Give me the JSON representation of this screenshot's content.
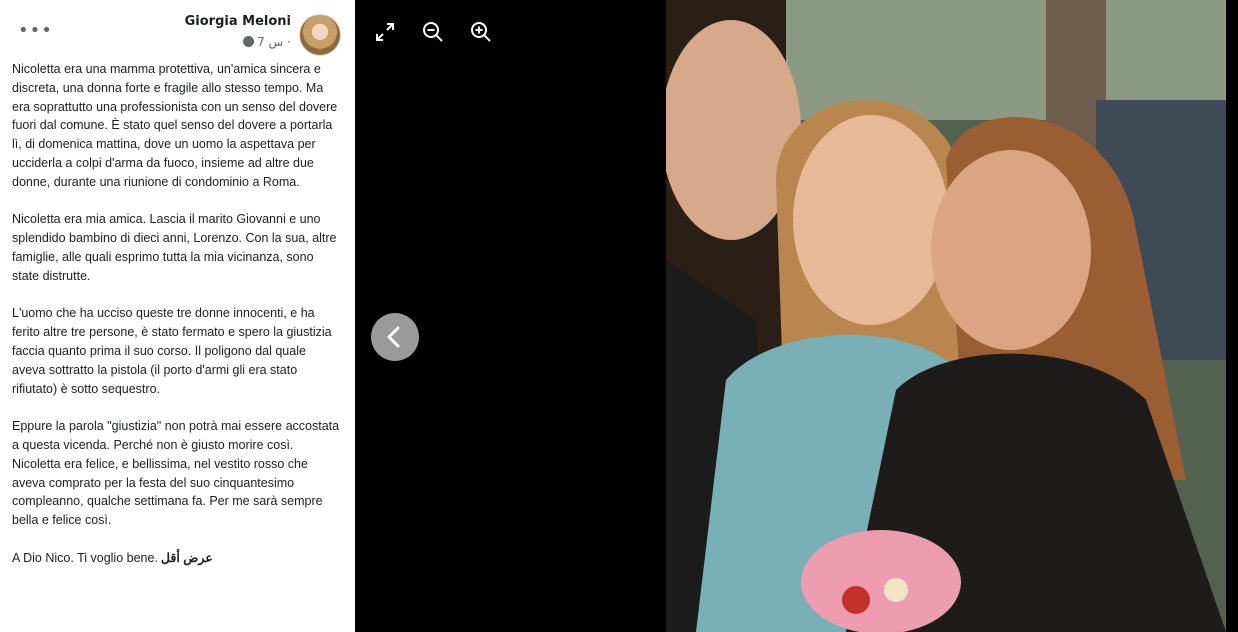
{
  "post": {
    "author": "Giorgia Meloni",
    "time": "7 س",
    "separator": "·",
    "paragraphs": [
      "Nicoletta era una mamma protettiva, un'amica sincera e discreta, una donna forte e fragile allo stesso tempo. Ma era soprattutto una professionista con un senso del dovere fuori dal comune. È stato quel senso del dovere a portarla lì, di domenica mattina, dove un uomo la aspettava per ucciderla a colpi d'arma da fuoco, insieme ad altre due donne, durante una riunione di condominio a Roma.",
      "Nicoletta era mia amica. Lascia il marito Giovanni e uno splendido bambino di dieci anni, Lorenzo. Con la sua, altre famiglie, alle quali esprimo tutta la mia vicinanza, sono state distrutte.",
      "L'uomo che ha ucciso queste tre donne innocenti, e ha ferito altre tre persone, è stato fermato e spero la giustizia faccia quanto prima il suo corso. Il poligono dal quale aveva sottratto la pistola (il porto d'armi gli era stato rifiutato) è sotto sequestro.",
      "Eppure la parola \"giustizia\" non potrà mai essere accostata a questa vicenda. Perché non è giusto morire così.",
      "Nicoletta era felice, e bellissima, nel vestito rosso che aveva comprato per la festa del suo cinquantesimo compleanno, qualche settimana fa. Per me sarà sempre bella e felice così.",
      "A Dio Nico. Ti voglio bene."
    ],
    "see_less": "عرض أقل"
  },
  "icons": {
    "more": "more-options-icon",
    "audience": "globe-icon",
    "expand": "expand-icon",
    "zoom_out": "zoom-out-icon",
    "zoom_in": "zoom-in-icon",
    "previous": "chevron-left-icon"
  },
  "colors": {
    "panel_bg": "#ffffff",
    "viewer_bg": "#000000",
    "text": "#1c1e21",
    "muted": "#65676b",
    "nav_button": "#9a9a9a"
  }
}
